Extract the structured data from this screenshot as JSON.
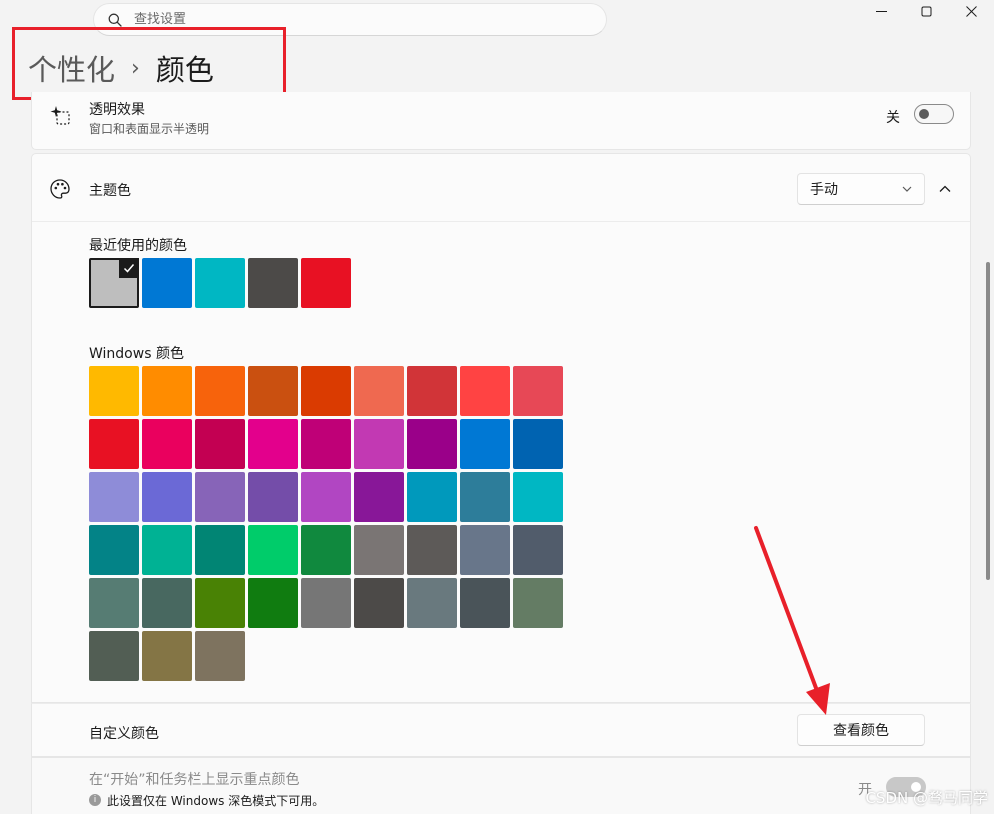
{
  "search": {
    "placeholder": "查找设置"
  },
  "breadcrumb": {
    "parent": "个性化",
    "separator": "›",
    "current": "颜色"
  },
  "transparency": {
    "title": "透明效果",
    "subtitle": "窗口和表面显示半透明",
    "state_label": "关",
    "enabled": false
  },
  "accent": {
    "title": "主题色",
    "mode": "手动",
    "recent_label": "最近使用的颜色",
    "recent_colors": [
      "#bebebe",
      "#0078d4",
      "#00b7c3",
      "#4c4a48",
      "#e81123"
    ],
    "selected_recent_index": 0,
    "windows_label": "Windows 颜色",
    "windows_colors": [
      "#ffb900",
      "#ff8c00",
      "#f7630c",
      "#ca5010",
      "#da3b01",
      "#ef6950",
      "#d13438",
      "#ff4343",
      "#e74856",
      "#e81123",
      "#ea005e",
      "#c30052",
      "#e3008c",
      "#bf0077",
      "#c239b3",
      "#9a0089",
      "#0078d4",
      "#0063b1",
      "#8e8cd8",
      "#6b69d6",
      "#8764b8",
      "#744da9",
      "#b146c2",
      "#881798",
      "#0099bc",
      "#2d7d9a",
      "#00b7c3",
      "#038387",
      "#00b294",
      "#018574",
      "#00cc6a",
      "#10893e",
      "#7a7574",
      "#5d5a58",
      "#68768a",
      "#515c6b",
      "#567c73",
      "#486860",
      "#498205",
      "#107c10",
      "#767676",
      "#4c4a48",
      "#69797e",
      "#4a5459",
      "#647c64",
      "#525e54",
      "#847545",
      "#7e735f"
    ]
  },
  "custom": {
    "label": "自定义颜色",
    "button_label": "查看颜色"
  },
  "start_taskbar": {
    "title": "在“开始”和任务栏上显示重点颜色",
    "note": "此设置仅在 Windows 深色模式下可用。",
    "state_label": "开",
    "enabled": true,
    "disabled": true
  },
  "watermark": "CSDN @骛马同学",
  "colors": {
    "annotation_red": "#e8202a"
  }
}
